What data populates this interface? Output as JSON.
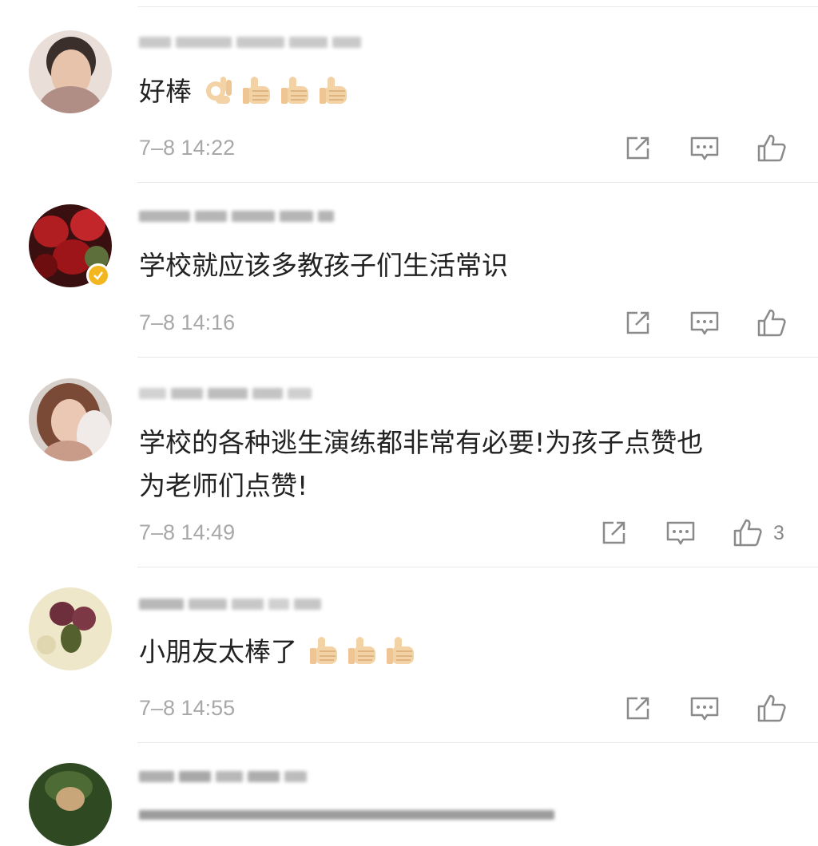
{
  "comments": [
    {
      "text": "好棒",
      "emojis": [
        "ok-hand",
        "thumbs-up",
        "thumbs-up",
        "thumbs-up"
      ],
      "time": "7–8 14:22",
      "like_count": ""
    },
    {
      "text": "学校就应该多教孩子们生活常识",
      "emojis": [],
      "time": "7–8 14:16",
      "like_count": "",
      "verified": true
    },
    {
      "text": "学校的各种逃生演练都非常有必要!为孩子点赞也\n为老师们点赞!",
      "emojis": [],
      "time": "7–8 14:49",
      "like_count": "3"
    },
    {
      "text": "小朋友太棒了",
      "emojis": [
        "thumbs-up",
        "thumbs-up",
        "thumbs-up"
      ],
      "time": "7–8 14:55",
      "like_count": ""
    },
    {
      "text": "",
      "emojis": [],
      "time": "",
      "like_count": ""
    }
  ],
  "colors": {
    "text": "#222222",
    "meta": "#a8a8a8",
    "icon": "#8a8a8a",
    "verified_badge": "#f2b61f",
    "emoji_skin": "#f3d2a6"
  }
}
